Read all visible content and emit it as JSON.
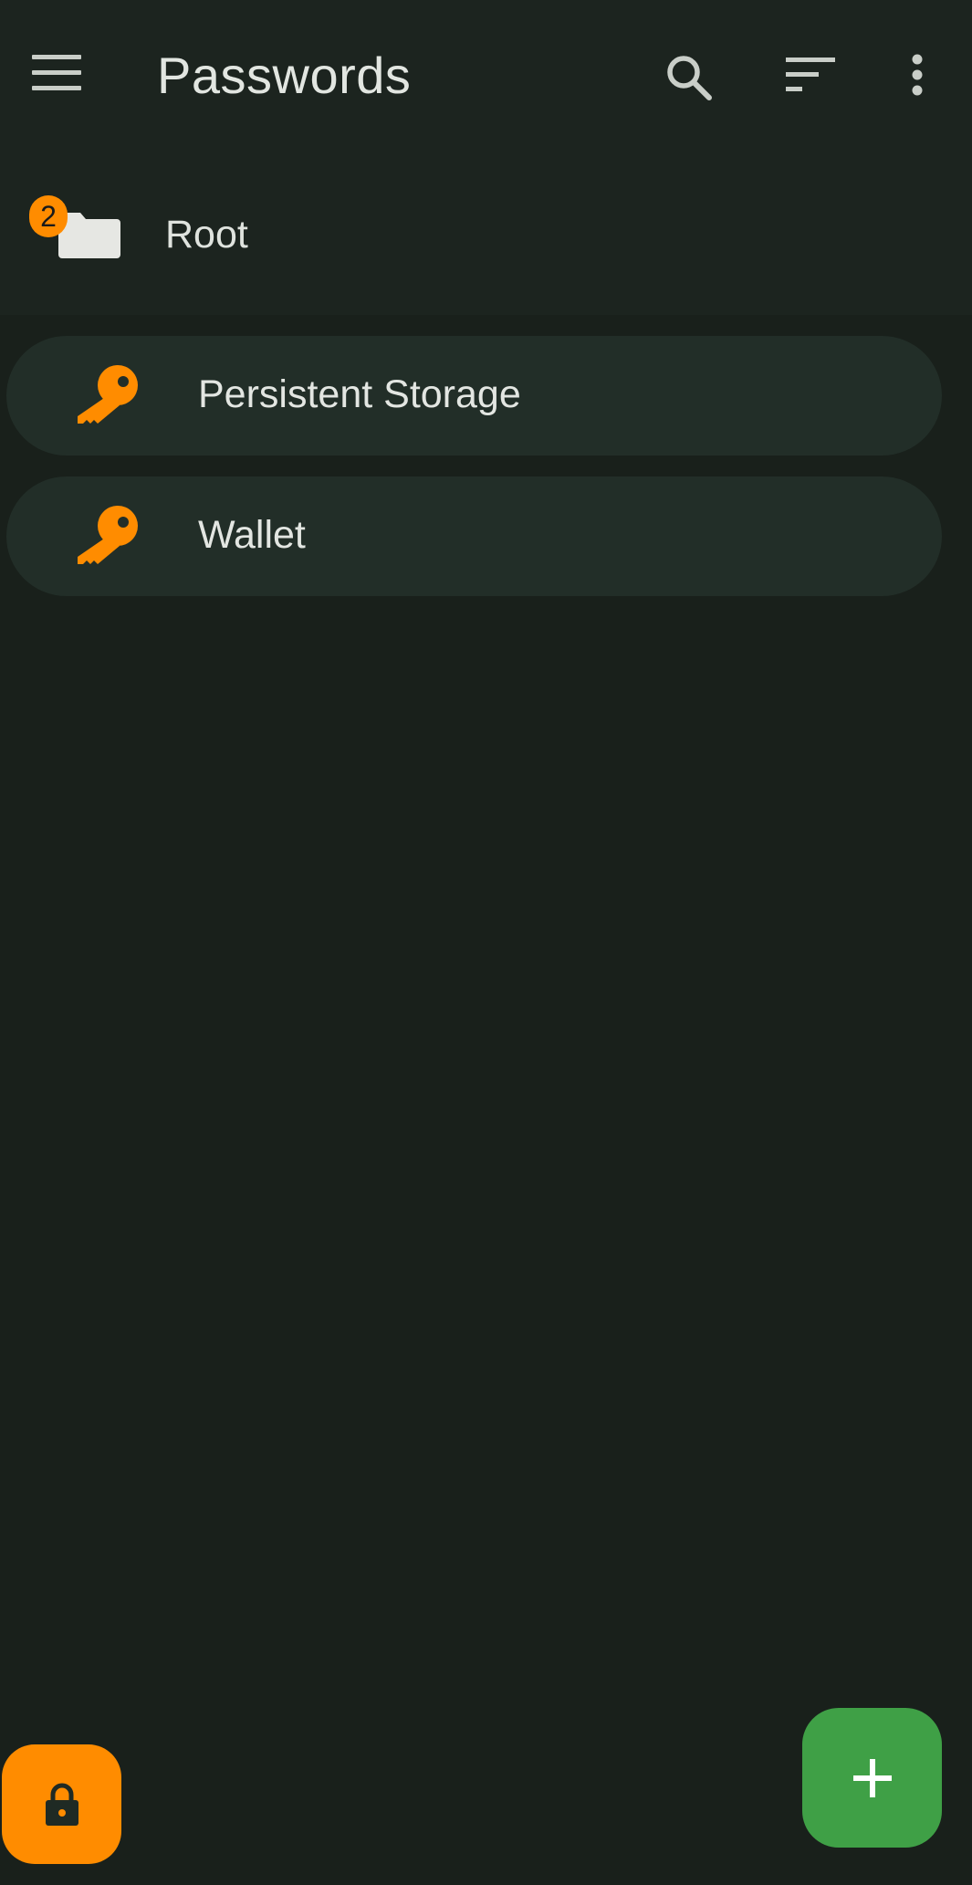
{
  "topbar": {
    "title": "Passwords",
    "menu_icon": "hamburger-menu-icon",
    "search_icon": "search-icon",
    "sort_icon": "sort-icon",
    "overflow_icon": "more-vertical-icon"
  },
  "folder": {
    "label": "Root",
    "badge_count": "2",
    "icon": "folder-icon"
  },
  "entries": [
    {
      "label": "Persistent Storage",
      "icon": "key-icon"
    },
    {
      "label": "Wallet",
      "icon": "key-icon"
    }
  ],
  "fabs": {
    "lock_icon": "lock-icon",
    "add_icon": "plus-icon"
  },
  "colors": {
    "background": "#19201b",
    "accent_orange": "#ff8c00",
    "accent_green": "#3fa046",
    "entry_bg": "#222e28"
  }
}
